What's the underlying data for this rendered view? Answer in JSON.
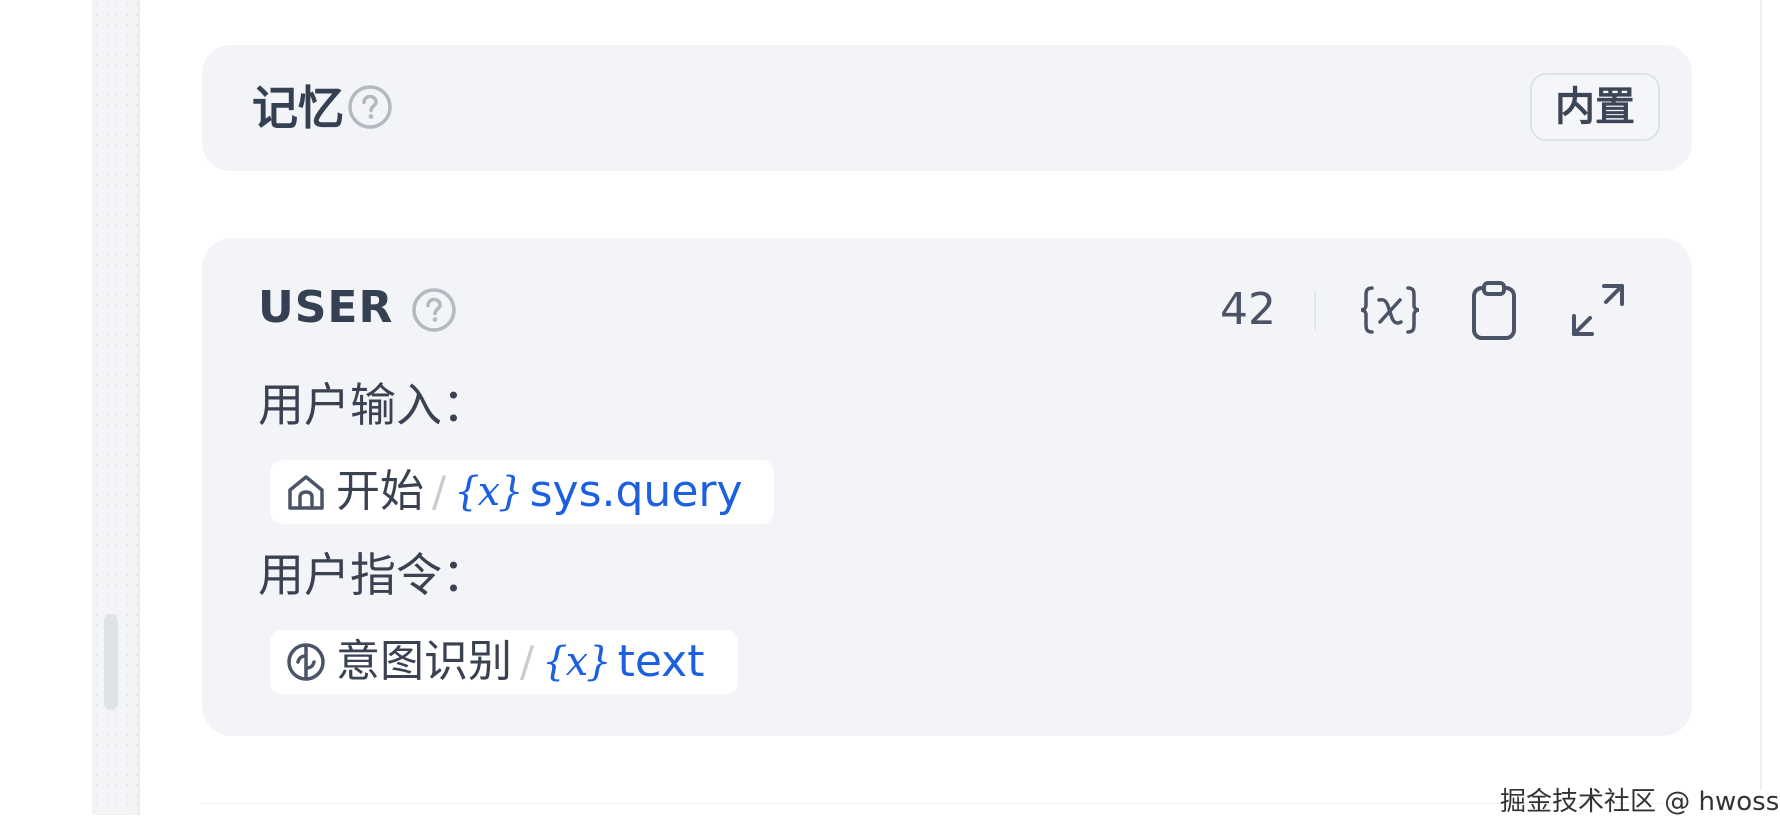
{
  "memory": {
    "title": "记忆",
    "badge": "内置"
  },
  "prompt": {
    "role": "USER",
    "token_count": "42",
    "lines": [
      {
        "label": "用户输入：",
        "node": "开始",
        "node_icon": "home-icon",
        "separator": "/",
        "var_icon": "{x}",
        "variable": "sys.query"
      },
      {
        "label": "用户指令：",
        "node": "意图识别",
        "node_icon": "intent-classifier-icon",
        "separator": "/",
        "var_icon": "{x}",
        "variable": "text"
      }
    ],
    "toolbar": {
      "insert_variable_icon": "variable-icon",
      "copy_icon": "clipboard-icon",
      "expand_icon": "expand-icon"
    }
  },
  "watermark": "掘金技术社区 @ hwoss",
  "colors": {
    "card_bg": "#f2f4f7",
    "accent": "#1c5fe0",
    "text": "#354052"
  }
}
